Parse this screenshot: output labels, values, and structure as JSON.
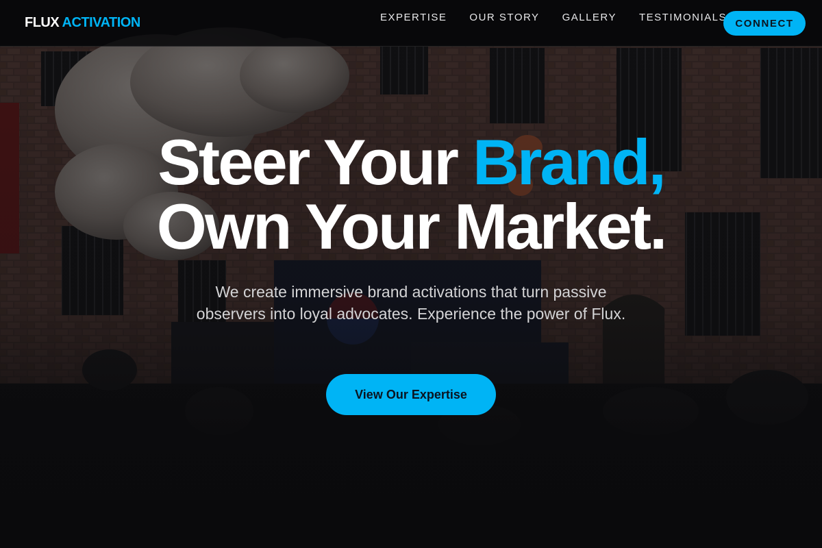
{
  "brand": {
    "name_part1": "FLUX",
    "name_part2": "ACTIVATION"
  },
  "colors": {
    "accent": "#00b4f5",
    "background": "#0b0b0c",
    "header_bg": "#08080a",
    "text": "#ffffff",
    "subtext": "#d4d4d6"
  },
  "nav": {
    "items": [
      {
        "label": "EXPERTISE"
      },
      {
        "label": "OUR STORY"
      },
      {
        "label": "GALLERY"
      },
      {
        "label": "TESTIMONIALS"
      }
    ],
    "cta_label": "CONNECT"
  },
  "hero": {
    "headline_line1_pre": "Steer Your ",
    "headline_line1_accent": "Brand,",
    "headline_line2": "Own Your Market.",
    "subtitle": "We create immersive brand activations that turn passive observers into loyal advocates. Experience the power of Flux.",
    "cta_label": "View Our Expertise"
  }
}
